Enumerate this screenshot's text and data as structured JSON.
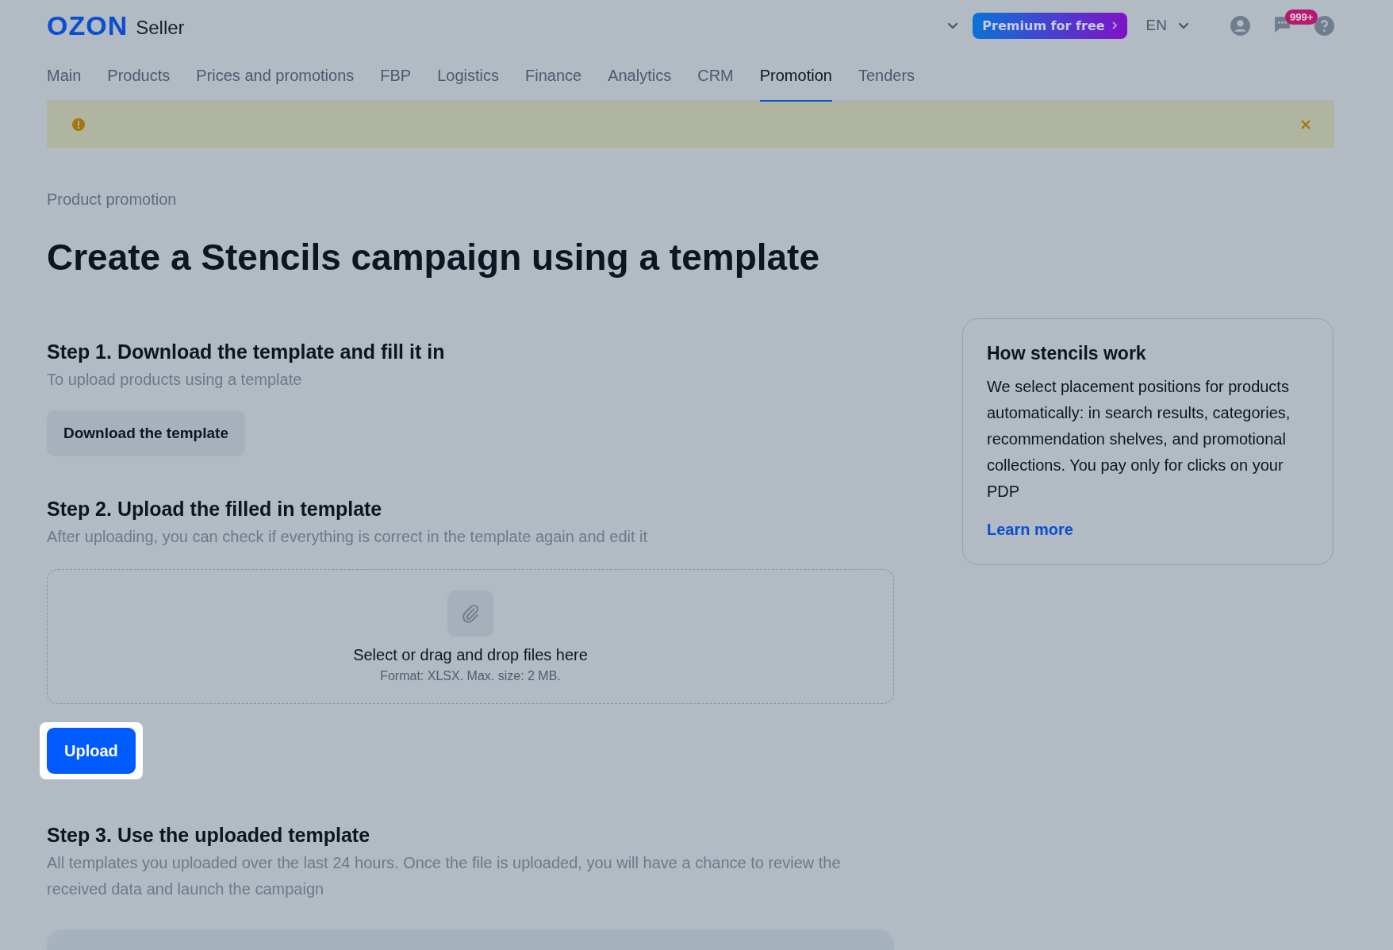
{
  "header": {
    "logo": "OZON",
    "logo_suffix": "Seller",
    "premium_button": "Premium for free",
    "language": "EN",
    "notification_count": "999+"
  },
  "tabs": [
    {
      "label": "Main",
      "selected": false
    },
    {
      "label": "Products",
      "selected": false
    },
    {
      "label": "Prices and promotions",
      "selected": false
    },
    {
      "label": "FBP",
      "selected": false
    },
    {
      "label": "Logistics",
      "selected": false
    },
    {
      "label": "Finance",
      "selected": false
    },
    {
      "label": "Analytics",
      "selected": false
    },
    {
      "label": "CRM",
      "selected": false
    },
    {
      "label": "Promotion",
      "selected": true
    },
    {
      "label": "Tenders",
      "selected": false
    }
  ],
  "breadcrumb": "Product promotion",
  "title": "Create a Stencils campaign using a template",
  "step1": {
    "heading": "Step 1. Download the template and fill it in",
    "subtitle": "To upload products using a template",
    "button": "Download the template"
  },
  "step2": {
    "heading": "Step 2. Upload the filled in template",
    "subtitle": "After uploading, you can check if everything is correct in the template again and edit it",
    "dropzone_text": "Select or drag and drop files here",
    "dropzone_hint": "Format: XLSX. Max. size: 2 MB.",
    "button": "Upload"
  },
  "step3": {
    "heading": "Step 3. Use the uploaded template",
    "subtitle": "All templates you uploaded over the last 24 hours. Once the file is uploaded, you will have a chance to review the received data and launch the campaign"
  },
  "info_card": {
    "title": "How stencils work",
    "text": "We select placement positions for products automatically: in search results, categories, recommendation shelves, and promotional collections. You pay only for clicks on your PDP",
    "link": "Learn more"
  }
}
